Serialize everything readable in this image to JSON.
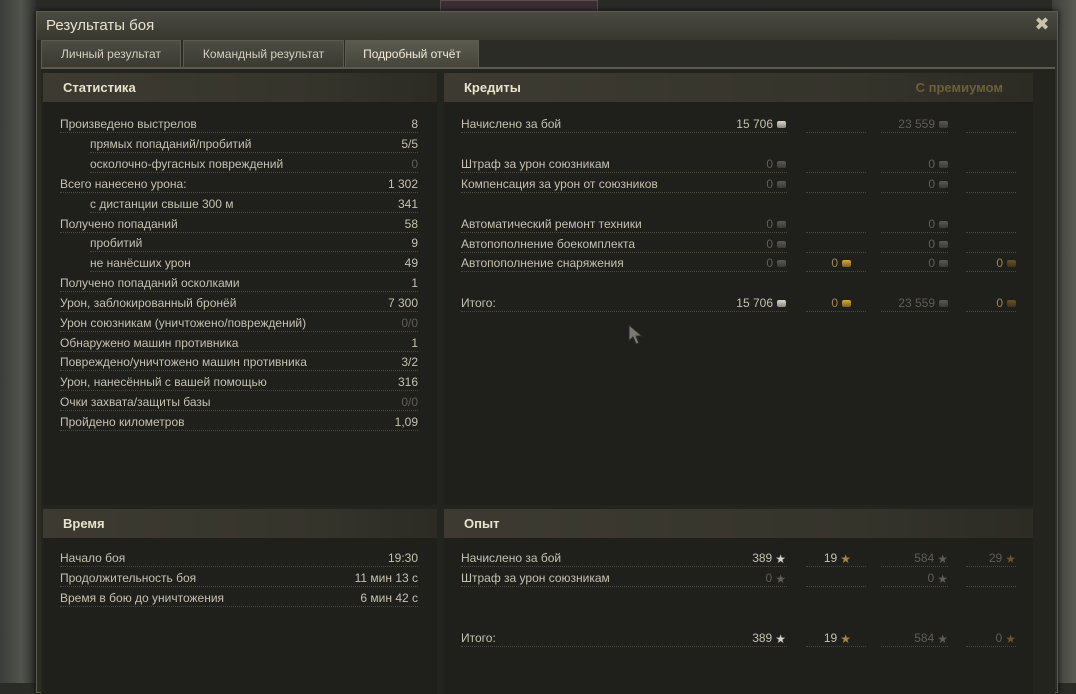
{
  "window": {
    "title": "Результаты боя",
    "close_symbol": "✖"
  },
  "tabs": [
    {
      "label": "Личный результат"
    },
    {
      "label": "Командный результат"
    },
    {
      "label": "Подробный отчёт"
    }
  ],
  "stats": {
    "header": "Статистика",
    "rows": [
      {
        "label": "Произведено выстрелов",
        "value": "8"
      },
      {
        "label": "прямых попаданий/пробитий",
        "value": "5/5"
      },
      {
        "label": "осколочно-фугасных повреждений",
        "value": "0"
      },
      {
        "label": "Всего нанесено урона:",
        "value": "1 302"
      },
      {
        "label": "с дистанции свыше 300 м",
        "value": "341"
      },
      {
        "label": "Получено попаданий",
        "value": "58"
      },
      {
        "label": "пробитий",
        "value": "9"
      },
      {
        "label": "не нанёсших урон",
        "value": "49"
      },
      {
        "label": "Получено попаданий осколками",
        "value": "1"
      },
      {
        "label": "Урон, заблокированный бронёй",
        "value": "7 300"
      },
      {
        "label": "Урон союзникам (уничтожено/повреждений)",
        "value": "0/0"
      },
      {
        "label": "Обнаружено машин противника",
        "value": "1"
      },
      {
        "label": "Повреждено/уничтожено машин противника",
        "value": "3/2"
      },
      {
        "label": "Урон, нанесённый с вашей помощью",
        "value": "316"
      },
      {
        "label": "Очки захвата/защиты базы",
        "value": "0/0"
      },
      {
        "label": "Пройдено километров",
        "value": "1,09"
      }
    ]
  },
  "credits": {
    "header": "Кредиты",
    "premium_header": "С премиумом",
    "rows": [
      {
        "label": "Начислено за бой",
        "c1": "15 706",
        "c3": "23 559"
      },
      {
        "label": "Штраф за урон союзникам",
        "c1": "0",
        "c3": "0"
      },
      {
        "label": "Компенсация за урон от союзников",
        "c1": "0",
        "c3": "0"
      },
      {
        "label": "Автоматический ремонт техники",
        "c1": "0",
        "c3": "0"
      },
      {
        "label": "Автопополнение боекомплекта",
        "c1": "0",
        "c3": "0"
      },
      {
        "label": "Автопополнение снаряжения",
        "c1": "0",
        "c2": "0",
        "c3": "0",
        "c4": "0"
      },
      {
        "label": "Итого:",
        "c1": "15 706",
        "c2": "0",
        "c3": "23 559",
        "c4": "0"
      }
    ]
  },
  "time": {
    "header": "Время",
    "rows": [
      {
        "label": "Начало боя",
        "value": "19:30"
      },
      {
        "label": "Продолжительность боя",
        "value": "11 мин 13 с"
      },
      {
        "label": "Время в бою до уничтожения",
        "value": "6 мин 42 с"
      }
    ]
  },
  "xp": {
    "header": "Опыт",
    "rows": [
      {
        "label": "Начислено за бой",
        "c1": "389",
        "c2": "19",
        "c3": "584",
        "c4": "29"
      },
      {
        "label": "Штраф за урон союзникам",
        "c1": "0",
        "c3": "0"
      },
      {
        "label": "Итого:",
        "c1": "389",
        "c2": "19",
        "c3": "584",
        "c4": "0"
      }
    ]
  },
  "icons": {
    "star": "★"
  }
}
